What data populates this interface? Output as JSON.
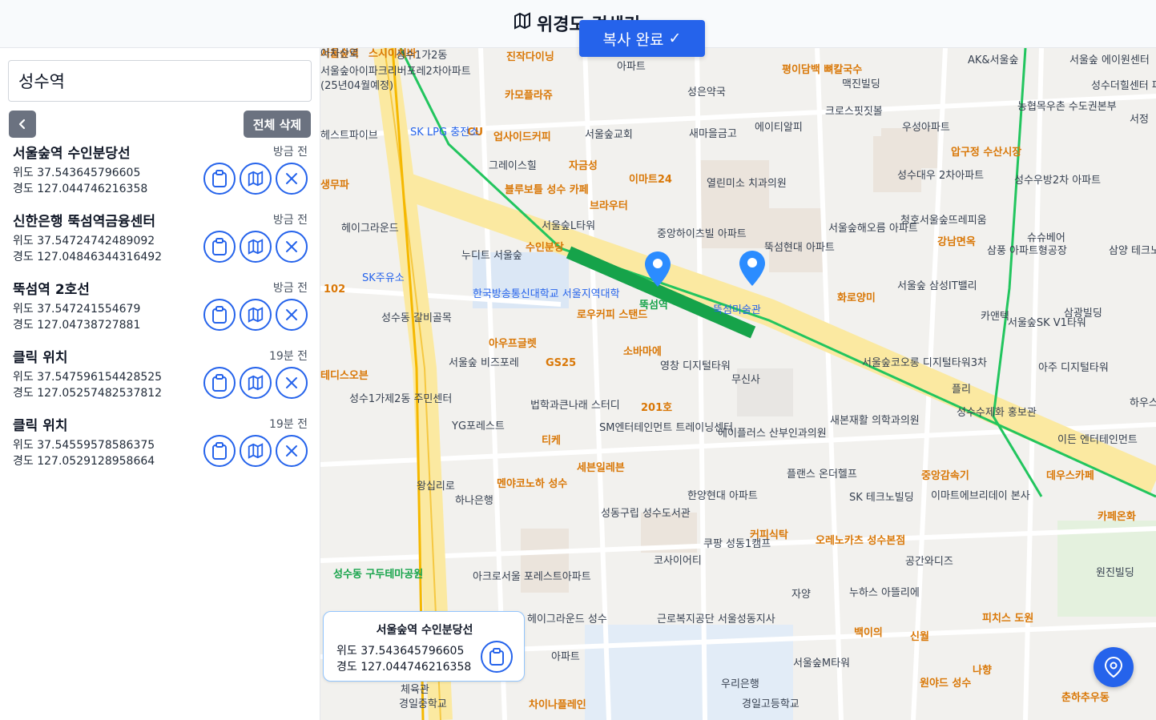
{
  "app": {
    "title": "위경도 검색기",
    "toast": "복사 완료",
    "toast_check": "✓"
  },
  "search": {
    "value": "성수역"
  },
  "toolbar": {
    "clear_label": "전체 삭제"
  },
  "labels": {
    "lat": "위도",
    "lng": "경도"
  },
  "results": [
    {
      "name": "서울숲역 수인분당선",
      "time": "방금 전",
      "lat": "37.543645796605",
      "lng": "127.044746216358"
    },
    {
      "name": "신한은행 뚝섬역금융센터",
      "time": "방금 전",
      "lat": "37.54724742489092",
      "lng": "127.04846344316492"
    },
    {
      "name": "뚝섬역 2호선",
      "time": "방금 전",
      "lat": "37.547241554679",
      "lng": "127.04738727881"
    },
    {
      "name": "클릭 위치",
      "time": "19분 전",
      "lat": "37.547596154428525",
      "lng": "127.05257482537812"
    },
    {
      "name": "클릭 위치",
      "time": "19분 전",
      "lat": "37.54559578586375",
      "lng": "127.0529128958664"
    }
  ],
  "info_card": {
    "name": "서울숲역 수인분당선",
    "lat": "37.543645796605",
    "lng": "127.044746216358"
  },
  "map_labels": [
    {
      "text": "스시이치바",
      "cls": "orange"
    },
    {
      "text": "진작다이닝",
      "cls": "orange"
    },
    {
      "text": "카모플라쥬",
      "cls": "orange"
    },
    {
      "text": "CU",
      "cls": "orange"
    },
    {
      "text": "업사이드커피",
      "cls": "orange"
    },
    {
      "text": "자금성",
      "cls": "orange"
    },
    {
      "text": "이마트24",
      "cls": "orange"
    },
    {
      "text": "브라우터",
      "cls": "orange"
    },
    {
      "text": "블루보틀 성수 카페",
      "cls": "orange"
    },
    {
      "text": "평이담백 뼈칼국수",
      "cls": "orange"
    },
    {
      "text": "압구정 수산시장",
      "cls": "orange"
    },
    {
      "text": "강남면옥",
      "cls": "orange"
    },
    {
      "text": "화로양미",
      "cls": "orange"
    },
    {
      "text": "로우커피 스탠드",
      "cls": "orange"
    },
    {
      "text": "소바마에",
      "cls": "orange"
    },
    {
      "text": "아우프글렛",
      "cls": "orange"
    },
    {
      "text": "GS25",
      "cls": "orange"
    },
    {
      "text": "201호",
      "cls": "orange"
    },
    {
      "text": "티케",
      "cls": "orange"
    },
    {
      "text": "세븐일레븐",
      "cls": "orange"
    },
    {
      "text": "멘야코노하 성수",
      "cls": "orange"
    },
    {
      "text": "커피식탁",
      "cls": "orange"
    },
    {
      "text": "오레노카츠 성수본점",
      "cls": "orange"
    },
    {
      "text": "중앙감속기",
      "cls": "orange"
    },
    {
      "text": "데우스카페",
      "cls": "orange"
    },
    {
      "text": "카페온화",
      "cls": "orange"
    },
    {
      "text": "백이의",
      "cls": "orange"
    },
    {
      "text": "신월",
      "cls": "orange"
    },
    {
      "text": "피치스 도원",
      "cls": "orange"
    },
    {
      "text": "나향",
      "cls": "orange"
    },
    {
      "text": "원야드 성수",
      "cls": "orange"
    },
    {
      "text": "춘하추우동",
      "cls": "orange"
    },
    {
      "text": "차이나플레인",
      "cls": "orange"
    },
    {
      "text": "뚝섬역",
      "cls": "green"
    },
    {
      "text": "뚝섬미술관",
      "cls": "blue"
    },
    {
      "text": "한국방송통신대학교 서울지역대학",
      "cls": "blue"
    },
    {
      "text": "서울숲아이파크리버포레2차아파트",
      "cls": ""
    },
    {
      "text": "(25년04월예정)",
      "cls": ""
    },
    {
      "text": "성수1가2동",
      "cls": ""
    },
    {
      "text": "아파트",
      "cls": ""
    },
    {
      "text": "성은약국",
      "cls": ""
    },
    {
      "text": "서울숲 에이원센터",
      "cls": ""
    },
    {
      "text": "AK&서울숲",
      "cls": ""
    },
    {
      "text": "맥진빌딩",
      "cls": ""
    },
    {
      "text": "성수더힐센터 파크뷰오피스",
      "cls": ""
    },
    {
      "text": "SK LPG 충전소",
      "cls": "blue"
    },
    {
      "text": "서울숲교회",
      "cls": ""
    },
    {
      "text": "새마을금고",
      "cls": ""
    },
    {
      "text": "에이티알피",
      "cls": ""
    },
    {
      "text": "크로스핏짓볼",
      "cls": ""
    },
    {
      "text": "우성아파트",
      "cls": ""
    },
    {
      "text": "농협목우촌 수도권본부",
      "cls": ""
    },
    {
      "text": "서정",
      "cls": ""
    },
    {
      "text": "헤스트파이브",
      "cls": ""
    },
    {
      "text": "그레이스힐",
      "cls": ""
    },
    {
      "text": "열린미소 치과의원",
      "cls": ""
    },
    {
      "text": "성수대우 2차아파트",
      "cls": ""
    },
    {
      "text": "성수우방2차 아파트",
      "cls": ""
    },
    {
      "text": "생무파",
      "cls": "orange"
    },
    {
      "text": "서울숲L타워",
      "cls": ""
    },
    {
      "text": "중앙하이츠빌 아파트",
      "cls": ""
    },
    {
      "text": "청호서울숲뜨레피움",
      "cls": ""
    },
    {
      "text": "헤이그라운드",
      "cls": ""
    },
    {
      "text": "누디트 서울숲",
      "cls": ""
    },
    {
      "text": "뚝섬현대 아파트",
      "cls": ""
    },
    {
      "text": "서울숲해오름 아파트",
      "cls": ""
    },
    {
      "text": "슈슈베어",
      "cls": ""
    },
    {
      "text": "삼풍 아파트형공장",
      "cls": ""
    },
    {
      "text": "삼양 테크노타",
      "cls": ""
    },
    {
      "text": "SK주유소",
      "cls": "blue"
    },
    {
      "text": "서울숲 삼성IT밸리",
      "cls": ""
    },
    {
      "text": "카앤텍",
      "cls": ""
    },
    {
      "text": "서울숲SK V1타워",
      "cls": ""
    },
    {
      "text": "삼광빌딩",
      "cls": ""
    },
    {
      "text": "102",
      "cls": "orange"
    },
    {
      "text": "성수동 갈비골목",
      "cls": ""
    },
    {
      "text": "영창 디지털타워",
      "cls": ""
    },
    {
      "text": "무신사",
      "cls": ""
    },
    {
      "text": "서울숲코오롱 디지털타워3차",
      "cls": ""
    },
    {
      "text": "아주 디지털타워",
      "cls": ""
    },
    {
      "text": "하우스 세종터",
      "cls": ""
    },
    {
      "text": "테디스오븐",
      "cls": "orange"
    },
    {
      "text": "서울숲 비즈포레",
      "cls": ""
    },
    {
      "text": "플리",
      "cls": ""
    },
    {
      "text": "성수1가제2동 주민센터",
      "cls": ""
    },
    {
      "text": "YG포레스트",
      "cls": ""
    },
    {
      "text": "법학과큰나래 스터디",
      "cls": ""
    },
    {
      "text": "SM엔터테인먼트 트레이닝센터",
      "cls": ""
    },
    {
      "text": "에이플러스 산부인과의원",
      "cls": ""
    },
    {
      "text": "새본재활 의학과의원",
      "cls": ""
    },
    {
      "text": "성수수제화 홍보관",
      "cls": ""
    },
    {
      "text": "이든 엔터테인먼트",
      "cls": ""
    },
    {
      "text": "왕십리로",
      "cls": ""
    },
    {
      "text": "하나은행",
      "cls": ""
    },
    {
      "text": "플랜스 온더헬프",
      "cls": ""
    },
    {
      "text": "이마트에브리데이 본사",
      "cls": ""
    },
    {
      "text": "한양현대 아파트",
      "cls": ""
    },
    {
      "text": "성동구립 성수도서관",
      "cls": ""
    },
    {
      "text": "SK 테크노빌딩",
      "cls": ""
    },
    {
      "text": "공간와디즈",
      "cls": ""
    },
    {
      "text": "원진빌딩",
      "cls": ""
    },
    {
      "text": "성수동 구두테마공원",
      "cls": "green"
    },
    {
      "text": "아크로서울 포레스트아파트",
      "cls": ""
    },
    {
      "text": "코사이어티",
      "cls": ""
    },
    {
      "text": "쿠팡 성동1캠프",
      "cls": ""
    },
    {
      "text": "자양",
      "cls": ""
    },
    {
      "text": "누하스 아뜰리에",
      "cls": ""
    },
    {
      "text": "근로복지공단 서울성동지사",
      "cls": ""
    },
    {
      "text": "헤이그라운드 성수",
      "cls": ""
    },
    {
      "text": "아파트",
      "cls": ""
    },
    {
      "text": "서울숲M타워",
      "cls": ""
    },
    {
      "text": "우리은행",
      "cls": ""
    },
    {
      "text": "경일고등학교",
      "cls": ""
    },
    {
      "text": "체육관",
      "cls": ""
    },
    {
      "text": "경일중학교",
      "cls": ""
    },
    {
      "text": "수인분당",
      "cls": "orange"
    },
    {
      "text": "서울숲역",
      "cls": "orange"
    },
    {
      "text": "아차산로",
      "cls": ""
    }
  ]
}
